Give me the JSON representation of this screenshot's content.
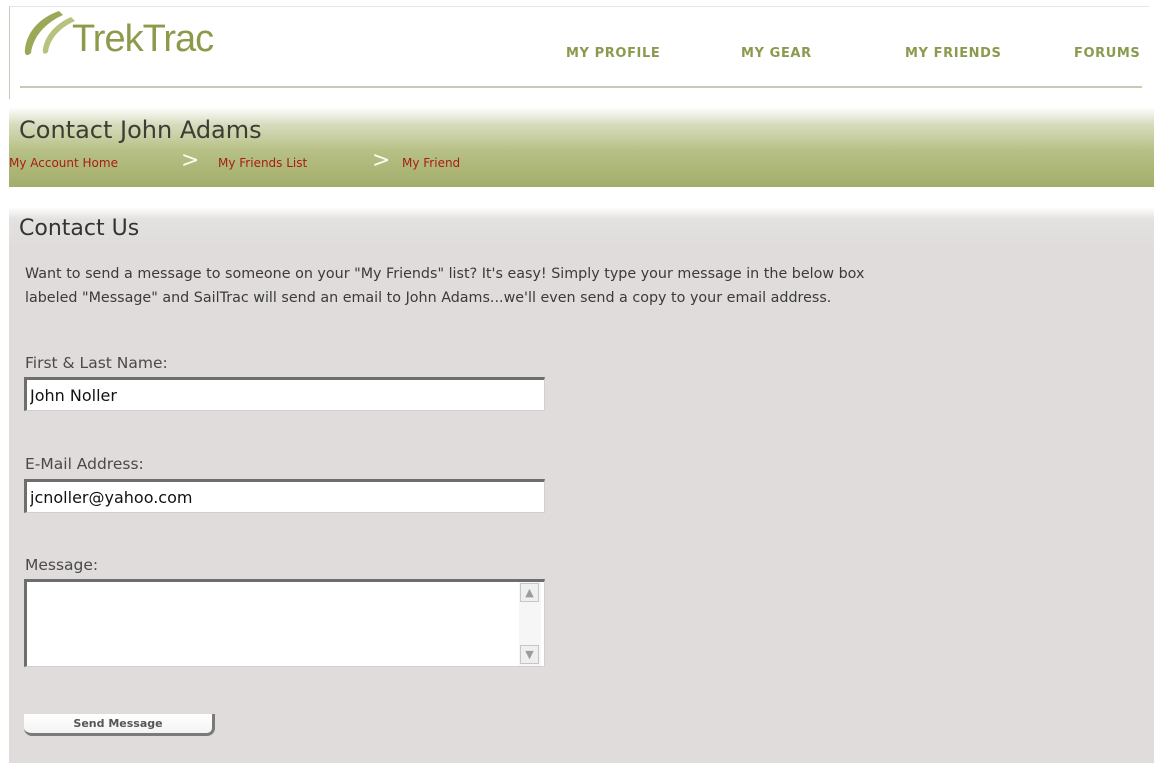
{
  "brand": {
    "logo_text": "TrekTrac",
    "logo_color": "#8c9b4a"
  },
  "nav": {
    "items": [
      {
        "label": "MY PROFILE"
      },
      {
        "label": "MY GEAR"
      },
      {
        "label": "MY FRIENDS"
      },
      {
        "label": "FORUMS"
      }
    ]
  },
  "banner": {
    "title": "Contact John Adams",
    "breadcrumb": [
      {
        "label": "My Account Home"
      },
      {
        "label": "My Friends List"
      },
      {
        "label": "My Friend"
      }
    ],
    "separator": ">"
  },
  "form": {
    "section_title": "Contact Us",
    "intro_line1": "Want to send a message to someone on your \"My Friends\" list? It's easy! Simply type your message in the below box",
    "intro_line2": "labeled \"Message\" and SailTrac will send an email to John Adams...we'll even send a copy to your email address.",
    "name_label": "First & Last Name:",
    "name_value": "John Noller",
    "email_label": "E-Mail Address:",
    "email_value": "jcnoller@yahoo.com",
    "message_label": "Message:",
    "message_value": "",
    "scroll_up_icon": "▲",
    "scroll_down_icon": "▼",
    "submit_label": "Send Message"
  },
  "colors": {
    "nav": "#8a9a4e",
    "breadcrumb_link": "#a81d13",
    "banner_green": "#a3ad6a",
    "content_bg": "#dfdcdb"
  }
}
